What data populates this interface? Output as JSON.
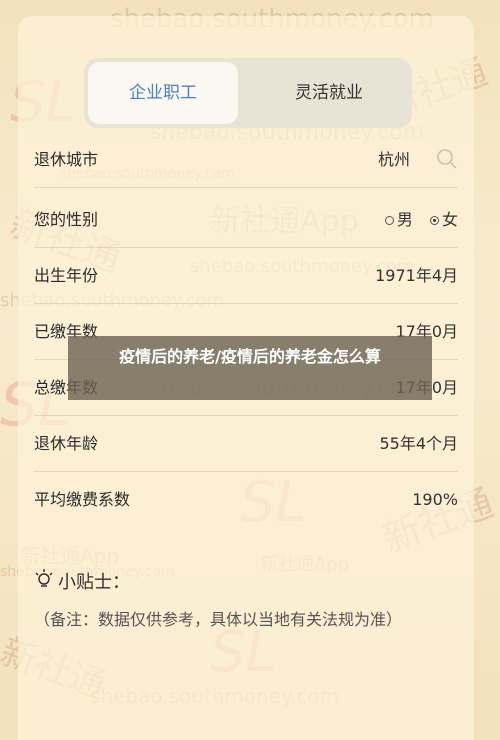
{
  "tabs": {
    "active": "企业职工",
    "inactive": "灵活就业"
  },
  "form": {
    "retire_city": {
      "label": "退休城市",
      "value": "杭州"
    },
    "gender": {
      "label": "您的性别",
      "options": [
        "男",
        "女"
      ],
      "selected": "女"
    },
    "birth": {
      "label": "出生年份",
      "value": "1971年4月"
    },
    "paid_years": {
      "label": "已缴年数",
      "value": "17年0月"
    },
    "total_years": {
      "label": "总缴年数",
      "value": "17年0月"
    },
    "retire_age": {
      "label": "退休年龄",
      "value": "55年4个月"
    },
    "avg_factor": {
      "label": "平均缴费系数",
      "value": "190%"
    }
  },
  "tips": {
    "title": "小贴士：",
    "note": "（备注：数据仅供参考，具体以当地有关法规为准）"
  },
  "overlay_title": "疫情后的养老/疫情后的养老金怎么算",
  "watermarks": {
    "site": "shebao.southmoney.com",
    "app": "新社通App",
    "app_short": "新社通",
    "logo": "SL"
  }
}
